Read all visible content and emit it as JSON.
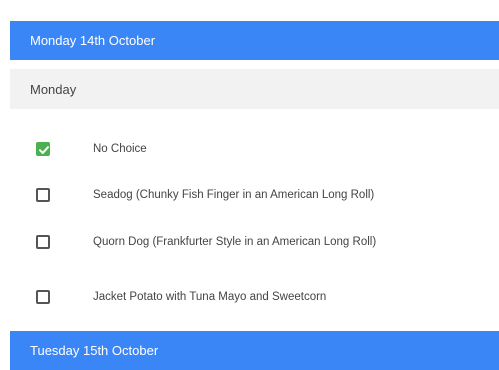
{
  "days": [
    {
      "header": "Monday 14th October",
      "sub_header": "Monday",
      "options": [
        {
          "label": "No Choice",
          "checked": true
        },
        {
          "label": "Seadog (Chunky Fish Finger in an American Long Roll)",
          "checked": false
        },
        {
          "label": "Quorn Dog (Frankfurter Style in an American Long Roll)",
          "checked": false
        },
        {
          "label": "Jacket Potato with Tuna Mayo and Sweetcorn",
          "checked": false
        }
      ]
    },
    {
      "header": "Tuesday 15th October"
    }
  ],
  "colors": {
    "header_bg": "#3b86f7",
    "sub_header_bg": "#f2f2f2",
    "checked": "#4caf50"
  },
  "icons": {
    "checked": "checkmark-icon",
    "unchecked": "empty-checkbox"
  }
}
